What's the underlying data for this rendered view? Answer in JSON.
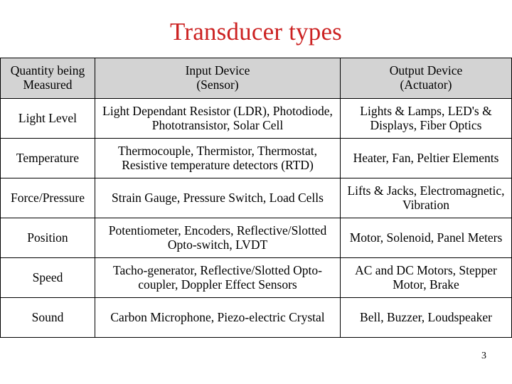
{
  "slide": {
    "title": "Transducer types",
    "title_color": "#cc2222",
    "page_number": "3"
  },
  "table": {
    "header_background": "#d3d3d3",
    "border_color": "#000000",
    "headers": [
      "Quantity being Measured",
      "Input Device (Sensor)",
      "Output Device (Actuator)"
    ],
    "headers_lines": [
      [
        "Quantity being",
        "Measured"
      ],
      [
        "Input Device",
        "(Sensor)"
      ],
      [
        "Output Device",
        "(Actuator)"
      ]
    ],
    "rows": [
      {
        "quantity": "Light Level",
        "input_device": "Light Dependant Resistor (LDR), Photodiode, Phototransistor, Solar Cell",
        "output_device": "Lights & Lamps, LED's & Displays, Fiber Optics"
      },
      {
        "quantity": "Temperature",
        "input_device": "Thermocouple, Thermistor, Thermostat, Resistive temperature detectors (RTD)",
        "output_device": "Heater, Fan, Peltier Elements"
      },
      {
        "quantity": "Force/Pressure",
        "input_device": "Strain Gauge, Pressure Switch, Load Cells",
        "output_device": "Lifts & Jacks, Electromagnetic, Vibration"
      },
      {
        "quantity": "Position",
        "input_device": "Potentiometer, Encoders, Reflective/Slotted Opto-switch, LVDT",
        "output_device": "Motor, Solenoid, Panel Meters"
      },
      {
        "quantity": "Speed",
        "input_device": "Tacho-generator, Reflective/Slotted Opto-coupler, Doppler Effect Sensors",
        "output_device": "AC and DC Motors, Stepper Motor, Brake"
      },
      {
        "quantity": "Sound",
        "input_device": "Carbon Microphone, Piezo-electric Crystal",
        "output_device": "Bell, Buzzer, Loudspeaker"
      }
    ]
  }
}
